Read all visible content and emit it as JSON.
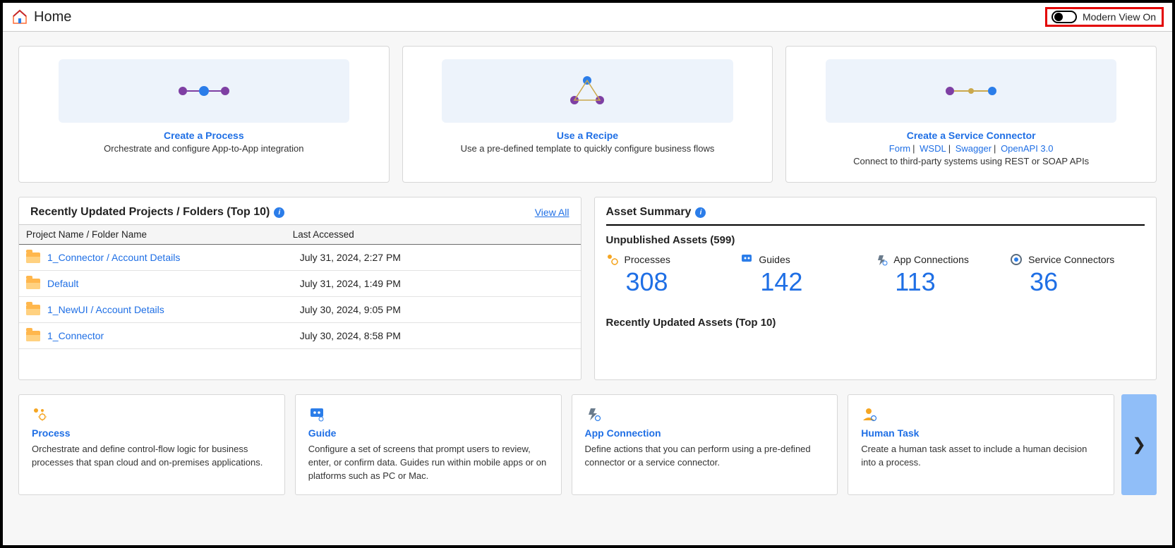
{
  "header": {
    "title": "Home",
    "toggle_label": "Modern View On"
  },
  "action_cards": [
    {
      "title": "Create a Process",
      "desc": "Orchestrate and configure App-to-App integration"
    },
    {
      "title": "Use a Recipe",
      "desc": "Use a pre-defined template to quickly configure business flows"
    },
    {
      "title": "Create a Service Connector",
      "links": [
        "Form",
        "WSDL",
        "Swagger",
        "OpenAPI 3.0"
      ],
      "desc": "Connect to third-party systems using REST or SOAP APIs"
    }
  ],
  "recent": {
    "title": "Recently Updated Projects / Folders (Top 10)",
    "view_all": "View All",
    "columns": [
      "Project Name / Folder Name",
      "Last Accessed"
    ],
    "rows": [
      {
        "name": "1_Connector / Account Details",
        "accessed": "July 31, 2024, 2:27 PM"
      },
      {
        "name": "Default",
        "accessed": "July 31, 2024, 1:49 PM"
      },
      {
        "name": "1_NewUI / Account Details",
        "accessed": "July 30, 2024, 9:05 PM"
      },
      {
        "name": "1_Connector",
        "accessed": "July 30, 2024, 8:58 PM"
      }
    ]
  },
  "summary": {
    "title": "Asset Summary",
    "unpublished_title": "Unpublished Assets (599)",
    "stats": [
      {
        "label": "Processes",
        "value": "308"
      },
      {
        "label": "Guides",
        "value": "142"
      },
      {
        "label": "App Connections",
        "value": "113"
      },
      {
        "label": "Service Connectors",
        "value": "36"
      }
    ],
    "recent_assets_title": "Recently Updated Assets (Top 10)"
  },
  "info_cards": [
    {
      "title": "Process",
      "desc": "Orchestrate and define control-flow logic for business processes that span cloud and on-premises applications."
    },
    {
      "title": "Guide",
      "desc": "Configure a set of screens that prompt users to review, enter, or confirm data. Guides run within mobile apps or on platforms such as PC or Mac."
    },
    {
      "title": "App Connection",
      "desc": "Define actions that you can perform using a pre-defined connector or a service connector."
    },
    {
      "title": "Human Task",
      "desc": "Create a human task asset to include a human decision into a process."
    }
  ]
}
